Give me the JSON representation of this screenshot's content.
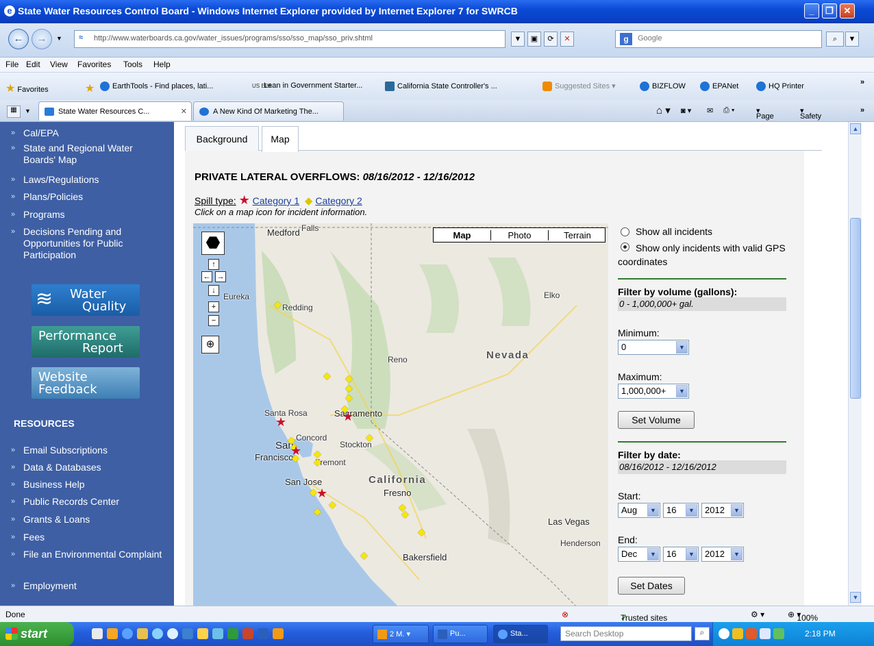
{
  "window": {
    "title": "State Water Resources Control Board - Windows Internet Explorer provided by Internet Explorer 7 for SWRCB"
  },
  "address": {
    "url": "http://www.waterboards.ca.gov/water_issues/programs/sso/sso_map/sso_priv.shtml",
    "search_placeholder": "Google"
  },
  "menu": [
    "File",
    "Edit",
    "View",
    "Favorites",
    "Tools",
    "Help"
  ],
  "favorites": {
    "label": "Favorites",
    "items": [
      "EarthTools - Find places, lati...",
      "Lean in Government Starter...",
      "California State Controller's ...",
      "Suggested Sites",
      "BIZFLOW",
      "EPANet",
      "HQ Printer"
    ],
    "epa_badge": "US EPA"
  },
  "tabs": [
    {
      "label": "State Water Resources C...",
      "active": true
    },
    {
      "label": "A New Kind Of Marketing The...",
      "active": false
    }
  ],
  "commandbar": {
    "page": "Page",
    "safety": "Safety"
  },
  "sidebar": {
    "items_top": [
      "Cal/EPA",
      "State and Regional Water Boards' Map",
      "Laws/Regulations",
      "Plans/Policies",
      "Programs",
      "Decisions Pending and Opportunities for Public Participation"
    ],
    "promos": {
      "water_quality": {
        "line1": "Water",
        "line2": "Quality"
      },
      "performance": {
        "line1": "Performance",
        "line2": "Report"
      },
      "feedback": {
        "line1": "Website",
        "line2": "Feedback"
      }
    },
    "resources_heading": "RESOURCES",
    "items_resources": [
      "Email Subscriptions",
      "Data & Databases",
      "Business Help",
      "Public Records Center",
      "Grants & Loans",
      "Fees",
      "File an Environmental Complaint",
      "Employment"
    ]
  },
  "content_tabs": [
    "Background",
    "Map"
  ],
  "map_section": {
    "title": "PRIVATE LATERAL OVERFLOWS:",
    "date_range": "08/16/2012 - 12/16/2012",
    "spill_type_label": "Spill type:",
    "category1": "Category 1",
    "category2": "Category 2",
    "hint": "Click on a map icon for incident information.",
    "map_types": [
      "Map",
      "Photo",
      "Terrain"
    ],
    "labels": {
      "falls": "Falls",
      "medford": "Medford",
      "eureka": "Eureka",
      "redding": "Redding",
      "elko": "Elko",
      "nevada": "Nevada",
      "reno": "Reno",
      "santa_rosa": "Santa Rosa",
      "sacramento": "Sacramento",
      "concord": "Concord",
      "stockton": "Stockton",
      "san_francisco_1": "San",
      "san_francisco_2": "Francisco",
      "fremont": "Fremont",
      "san_jose": "San Jose",
      "california": "California",
      "fresno": "Fresno",
      "las_vegas": "Las Vegas",
      "henderson": "Henderson",
      "bakersfield": "Bakersfield"
    },
    "colors": {
      "category1": "#c8102e",
      "category2": "#f5e50f"
    }
  },
  "filters": {
    "show_all": "Show all incidents",
    "show_valid": "Show only incidents with valid GPS coordinates",
    "selected": "show_valid",
    "volume_heading": "Filter by volume (gallons):",
    "volume_range": "0 - 1,000,000+ gal.",
    "minimum_label": "Minimum:",
    "minimum_value": "0",
    "maximum_label": "Maximum:",
    "maximum_value": "1,000,000+",
    "set_volume": "Set Volume",
    "date_heading": "Filter by date:",
    "date_range": "08/16/2012 - 12/16/2012",
    "start_label": "Start:",
    "start": {
      "month": "Aug",
      "day": "16",
      "year": "2012"
    },
    "end_label": "End:",
    "end": {
      "month": "Dec",
      "day": "16",
      "year": "2012"
    },
    "set_dates": "Set Dates"
  },
  "status": {
    "text": "Done",
    "zone": "Trusted sites",
    "zoom": "100%"
  },
  "taskbar": {
    "start": "start",
    "buttons": [
      "2 M.",
      "Pu...",
      "Sta..."
    ],
    "search_placeholder": "Search Desktop",
    "clock": "2:18 PM"
  }
}
